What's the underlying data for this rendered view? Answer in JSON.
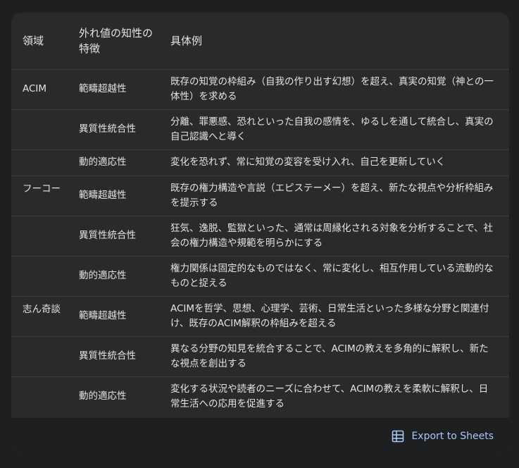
{
  "table": {
    "headers": [
      "領域",
      "外れ値の知性の特徴",
      "具体例"
    ],
    "rows": [
      {
        "domain": "ACIM",
        "trait": "範疇超越性",
        "example": "既存の知覚の枠組み（自我の作り出す幻想）を超え、真実の知覚（神との一体性）を求める"
      },
      {
        "domain": "",
        "trait": "異質性統合性",
        "example": "分離、罪悪感、恐れといった自我の感情を、ゆるしを通して統合し、真実の自己認識へと導く"
      },
      {
        "domain": "",
        "trait": "動的適応性",
        "example": "変化を恐れず、常に知覚の変容を受け入れ、自己を更新していく"
      },
      {
        "domain": "フーコー",
        "trait": "範疇超越性",
        "example": "既存の権力構造や言説（エピステーメー）を超え、新たな視点や分析枠組みを提示する"
      },
      {
        "domain": "",
        "trait": "異質性統合性",
        "example": "狂気、逸脱、監獄といった、通常は周縁化される対象を分析することで、社会の権力構造や規範を明らかにする"
      },
      {
        "domain": "",
        "trait": "動的適応性",
        "example": "権力関係は固定的なものではなく、常に変化し、相互作用している流動的なものと捉える"
      },
      {
        "domain": "志ん奇談",
        "trait": "範疇超越性",
        "example": "ACIMを哲学、思想、心理学、芸術、日常生活といった多様な分野と関連付け、既存のACIM解釈の枠組みを超える"
      },
      {
        "domain": "",
        "trait": "異質性統合性",
        "example": "異なる分野の知見を統合することで、ACIMの教えを多角的に解釈し、新たな視点を創出する"
      },
      {
        "domain": "",
        "trait": "動的適応性",
        "example": "変化する状況や読者のニーズに合わせて、ACIMの教えを柔軟に解釈し、日常生活への応用を促進する"
      }
    ]
  },
  "footer": {
    "export_label": "Export to Sheets",
    "export_icon": "table-grid-icon"
  },
  "colors": {
    "background": "#1e1f20",
    "card": "#282a2c",
    "divider": "#3c3d3f",
    "text": "#e3e3e3",
    "accent": "#a8c7fa"
  }
}
